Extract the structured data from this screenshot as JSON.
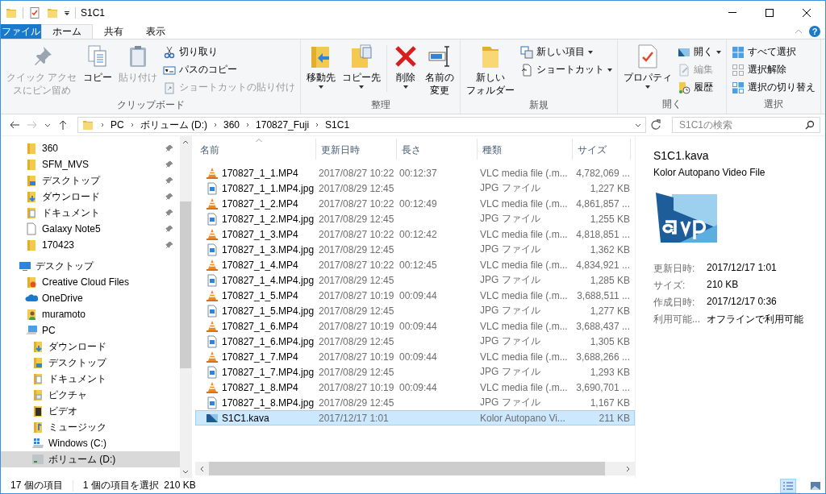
{
  "window": {
    "title": "S1C1"
  },
  "tabs": [
    {
      "label": "ファイル",
      "kind": "file",
      "selected": false
    },
    {
      "label": "ホーム",
      "kind": "tab",
      "selected": true
    },
    {
      "label": "共有",
      "kind": "tab",
      "selected": false
    },
    {
      "label": "表示",
      "kind": "tab",
      "selected": false
    }
  ],
  "ribbon_help": "?",
  "ribbon": [
    {
      "label": "クリップボード",
      "items": [
        {
          "kind": "large",
          "lines": [
            "クイック アクセ",
            "スにピン留め"
          ],
          "disabled": true,
          "dropdown": false
        },
        {
          "kind": "large",
          "lines": [
            "コピー"
          ],
          "disabled": false,
          "dropdown": false
        },
        {
          "kind": "large",
          "lines": [
            "貼り付け"
          ],
          "disabled": true,
          "dropdown": false
        },
        {
          "kind": "small",
          "label": "切り取り",
          "disabled": false,
          "dropdown": false
        },
        {
          "kind": "small",
          "label": "パスのコピー",
          "disabled": false,
          "dropdown": false
        },
        {
          "kind": "small",
          "label": "ショートカットの貼り付け",
          "disabled": true,
          "dropdown": false
        }
      ]
    },
    {
      "label": "整理",
      "items": [
        {
          "kind": "large",
          "lines": [
            "移動先"
          ],
          "disabled": false,
          "dropdown": true
        },
        {
          "kind": "large",
          "lines": [
            "コピー先"
          ],
          "disabled": false,
          "dropdown": true
        },
        {
          "kind": "separator"
        },
        {
          "kind": "large",
          "lines": [
            "削除"
          ],
          "disabled": false,
          "dropdown": true
        },
        {
          "kind": "large",
          "lines": [
            "名前の",
            "変更"
          ],
          "disabled": false,
          "dropdown": false
        }
      ]
    },
    {
      "label": "新規",
      "items": [
        {
          "kind": "large",
          "lines": [
            "新しい",
            "フォルダー"
          ],
          "disabled": false,
          "dropdown": false
        },
        {
          "kind": "small",
          "label": "新しい項目",
          "disabled": false,
          "dropdown": true
        },
        {
          "kind": "small",
          "label": "ショートカット",
          "disabled": false,
          "dropdown": true
        }
      ]
    },
    {
      "label": "開く",
      "items": [
        {
          "kind": "large",
          "lines": [
            "プロパティ"
          ],
          "disabled": false,
          "dropdown": true
        },
        {
          "kind": "small",
          "label": "開く",
          "disabled": false,
          "dropdown": true
        },
        {
          "kind": "small",
          "label": "編集",
          "disabled": true,
          "dropdown": false
        },
        {
          "kind": "small",
          "label": "履歴",
          "disabled": false,
          "dropdown": false
        }
      ]
    },
    {
      "label": "選択",
      "items": [
        {
          "kind": "small",
          "label": "すべて選択",
          "disabled": false,
          "dropdown": false
        },
        {
          "kind": "small",
          "label": "選択解除",
          "disabled": false,
          "dropdown": false
        },
        {
          "kind": "small",
          "label": "選択の切り替え",
          "disabled": false,
          "dropdown": false
        }
      ]
    }
  ],
  "address": {
    "segments": [
      "PC",
      "ボリューム (D:)",
      "360",
      "170827_Fuji",
      "S1C1"
    ]
  },
  "search": {
    "placeholder": "S1C1の検索"
  },
  "quick_access": [
    {
      "label": "360",
      "kind": "folder",
      "pinned": true
    },
    {
      "label": "SFM_MVS",
      "kind": "folder",
      "pinned": true
    },
    {
      "label": "デスクトップ",
      "kind": "desktop_folder",
      "pinned": true
    },
    {
      "label": "ダウンロード",
      "kind": "download_folder",
      "pinned": true
    },
    {
      "label": "ドキュメント",
      "kind": "documents_folder",
      "pinned": true
    },
    {
      "label": "Galaxy Note5",
      "kind": "file",
      "pinned": true
    },
    {
      "label": "170423",
      "kind": "folder",
      "pinned": true
    }
  ],
  "nav_tree": [
    {
      "label": "デスクトップ",
      "kind": "desktop",
      "selected": false,
      "children": [
        {
          "label": "Creative Cloud Files",
          "kind": "cc_folder",
          "selected": false
        },
        {
          "label": "OneDrive",
          "kind": "cloud",
          "selected": false
        },
        {
          "label": "muramoto",
          "kind": "user",
          "selected": false
        },
        {
          "label": "PC",
          "kind": "pc",
          "selected": false,
          "children": [
            {
              "label": "ダウンロード",
              "kind": "download_folder",
              "selected": false
            },
            {
              "label": "デスクトップ",
              "kind": "desktop_folder",
              "selected": false
            },
            {
              "label": "ドキュメント",
              "kind": "documents_folder",
              "selected": false
            },
            {
              "label": "ピクチャ",
              "kind": "pictures_folder",
              "selected": false
            },
            {
              "label": "ビデオ",
              "kind": "videos_folder",
              "selected": false
            },
            {
              "label": "ミュージック",
              "kind": "music_folder",
              "selected": false
            },
            {
              "label": "Windows (C:)",
              "kind": "windows_drive",
              "selected": false
            },
            {
              "label": "ボリューム (D:)",
              "kind": "drive",
              "selected": true
            }
          ]
        }
      ]
    }
  ],
  "table": {
    "columns": [
      {
        "label": "名前",
        "sorted": true
      },
      {
        "label": "更新日時",
        "sorted": false
      },
      {
        "label": "長さ",
        "sorted": false
      },
      {
        "label": "種類",
        "sorted": false
      },
      {
        "label": "サイズ",
        "sorted": false
      }
    ],
    "rows": [
      {
        "kind": "video",
        "name": "170827_1_1.MP4",
        "modified": "2017/08/27 10:22",
        "length": "00:12:37",
        "type": "VLC media file (.m...",
        "size": "4,782,069 ...",
        "selected": false
      },
      {
        "kind": "image",
        "name": "170827_1_1.MP4.jpg",
        "modified": "2017/08/29 12:45",
        "type": "JPG ファイル",
        "size": "1,227 KB",
        "selected": false
      },
      {
        "kind": "video",
        "name": "170827_1_2.MP4",
        "modified": "2017/08/27 10:22",
        "length": "00:12:49",
        "type": "VLC media file (.m...",
        "size": "4,861,857 ...",
        "selected": false
      },
      {
        "kind": "image",
        "name": "170827_1_2.MP4.jpg",
        "modified": "2017/08/29 12:45",
        "type": "JPG ファイル",
        "size": "1,255 KB",
        "selected": false
      },
      {
        "kind": "video",
        "name": "170827_1_3.MP4",
        "modified": "2017/08/27 10:22",
        "length": "00:12:42",
        "type": "VLC media file (.m...",
        "size": "4,818,851 ...",
        "selected": false
      },
      {
        "kind": "image",
        "name": "170827_1_3.MP4.jpg",
        "modified": "2017/08/29 12:45",
        "type": "JPG ファイル",
        "size": "1,362 KB",
        "selected": false
      },
      {
        "kind": "video",
        "name": "170827_1_4.MP4",
        "modified": "2017/08/27 10:22",
        "length": "00:12:45",
        "type": "VLC media file (.m...",
        "size": "4,834,921 ...",
        "selected": false
      },
      {
        "kind": "image",
        "name": "170827_1_4.MP4.jpg",
        "modified": "2017/08/29 12:45",
        "type": "JPG ファイル",
        "size": "1,285 KB",
        "selected": false
      },
      {
        "kind": "video",
        "name": "170827_1_5.MP4",
        "modified": "2017/08/27 10:19",
        "length": "00:09:44",
        "type": "VLC media file (.m...",
        "size": "3,688,511 ...",
        "selected": false
      },
      {
        "kind": "image",
        "name": "170827_1_5.MP4.jpg",
        "modified": "2017/08/29 12:45",
        "type": "JPG ファイル",
        "size": "1,277 KB",
        "selected": false
      },
      {
        "kind": "video",
        "name": "170827_1_6.MP4",
        "modified": "2017/08/27 10:19",
        "length": "00:09:44",
        "type": "VLC media file (.m...",
        "size": "3,688,437 ...",
        "selected": false
      },
      {
        "kind": "image",
        "name": "170827_1_6.MP4.jpg",
        "modified": "2017/08/29 12:45",
        "type": "JPG ファイル",
        "size": "1,305 KB",
        "selected": false
      },
      {
        "kind": "video",
        "name": "170827_1_7.MP4",
        "modified": "2017/08/27 10:19",
        "length": "00:09:44",
        "type": "VLC media file (.m...",
        "size": "3,688,266 ...",
        "selected": false
      },
      {
        "kind": "image",
        "name": "170827_1_7.MP4.jpg",
        "modified": "2017/08/29 12:45",
        "type": "JPG ファイル",
        "size": "1,293 KB",
        "selected": false
      },
      {
        "kind": "video",
        "name": "170827_1_8.MP4",
        "modified": "2017/08/27 10:19",
        "length": "00:09:44",
        "type": "VLC media file (.m...",
        "size": "3,690,701 ...",
        "selected": false
      },
      {
        "kind": "image",
        "name": "170827_1_8.MP4.jpg",
        "modified": "2017/08/29 12:45",
        "type": "JPG ファイル",
        "size": "1,167 KB",
        "selected": false
      },
      {
        "kind": "project",
        "name": "S1C1.kava",
        "modified": "2017/12/17 1:01",
        "type": "Kolor Autopano Vi...",
        "size": "211 KB",
        "selected": true
      }
    ]
  },
  "preview": {
    "title": "S1C1.kava",
    "subtitle": "Kolor Autopano Video File",
    "properties": [
      {
        "label": "更新日時:",
        "value": "2017/12/17 1:01"
      },
      {
        "label": "サイズ:",
        "value": "210 KB"
      },
      {
        "label": "作成日時:",
        "value": "2017/12/17 0:36"
      },
      {
        "label": "利用可能...",
        "value": "オフラインで利用可能"
      }
    ]
  },
  "status_bar": {
    "count": "17 個の項目",
    "selection": "1 個の項目を選択  210 KB",
    "views": [
      {
        "kind": "details",
        "selected": true
      },
      {
        "kind": "large_icons",
        "selected": false
      }
    ]
  }
}
